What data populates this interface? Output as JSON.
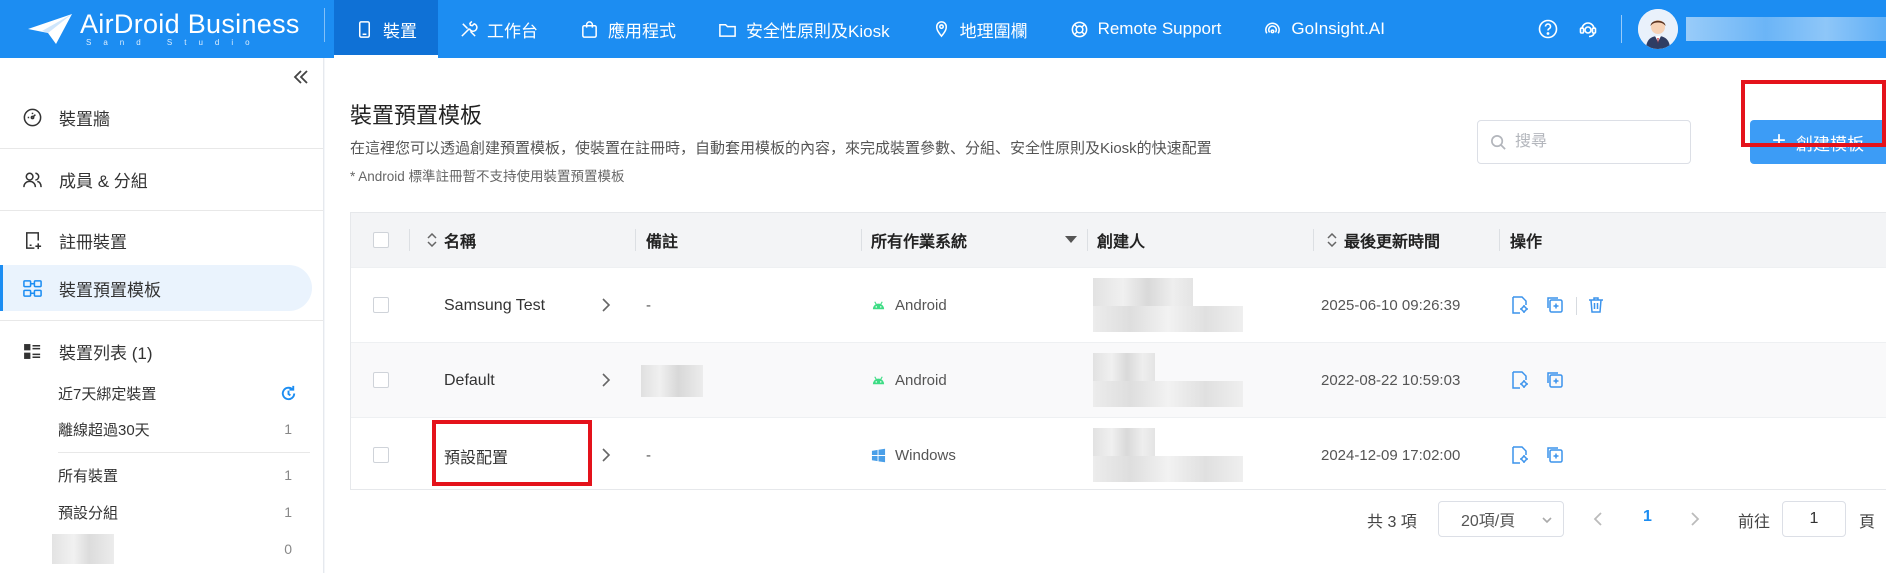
{
  "brand": {
    "name": "AirDroid Business",
    "sub": "Sand Studio"
  },
  "nav": [
    {
      "label": "裝置",
      "icon": "device-icon",
      "active": true
    },
    {
      "label": "工作台",
      "icon": "tools-icon"
    },
    {
      "label": "應用程式",
      "icon": "app-bag-icon"
    },
    {
      "label": "安全性原則及Kiosk",
      "icon": "folder-icon"
    },
    {
      "label": "地理圍欄",
      "icon": "geofence-icon"
    },
    {
      "label": "Remote Support",
      "icon": "lifebuoy-icon"
    },
    {
      "label": "GoInsight.AI",
      "icon": "ai-icon"
    }
  ],
  "sidebar": {
    "items": [
      {
        "label": "裝置牆",
        "icon": "dashboard-icon"
      },
      {
        "label": "成員 & 分組",
        "icon": "users-icon"
      },
      {
        "label": "註冊裝置",
        "icon": "enroll-icon"
      },
      {
        "label": "裝置預置模板",
        "icon": "template-icon",
        "active": true
      },
      {
        "label": "裝置列表 (1)",
        "icon": "list-icon"
      }
    ],
    "sub_items": [
      {
        "label": "近7天綁定裝置",
        "count": ""
      },
      {
        "label": "離線超過30天",
        "count": "1"
      },
      {
        "label": "所有裝置",
        "count": "1"
      },
      {
        "label": "預設分組",
        "count": "1"
      },
      {
        "label": "",
        "count": "0"
      }
    ]
  },
  "page": {
    "title": "裝置預置模板",
    "description": "在這裡您可以透過創建預置模板，使裝置在註冊時，自動套用模板的內容，來完成裝置參數、分組、安全性原則及Kiosk的快速配置",
    "note": "* Android 標準註冊暫不支持使用裝置預置模板",
    "search_placeholder": "搜尋",
    "create_label": "創建模板"
  },
  "table": {
    "headers": {
      "name": "名稱",
      "note": "備註",
      "os": "所有作業系統",
      "creator": "創建人",
      "updated": "最後更新時間",
      "actions": "操作"
    },
    "rows": [
      {
        "name": "Samsung Test",
        "note": "-",
        "os": "Android",
        "updated": "2025-06-10 09:26:39"
      },
      {
        "name": "Default",
        "note": "",
        "os": "Android",
        "updated": "2022-08-22 10:59:03"
      },
      {
        "name": "預設配置",
        "note": "-",
        "os": "Windows",
        "updated": "2024-12-09 17:02:00"
      }
    ]
  },
  "pagination": {
    "total": "共 3 項",
    "page_size": "20項/頁",
    "current": "1",
    "goto": "前往",
    "goto_value": "1",
    "page_suffix": "頁"
  },
  "colors": {
    "brand": "#1c8df2",
    "button": "#3c9cf6",
    "highlight": "#e4121b"
  }
}
